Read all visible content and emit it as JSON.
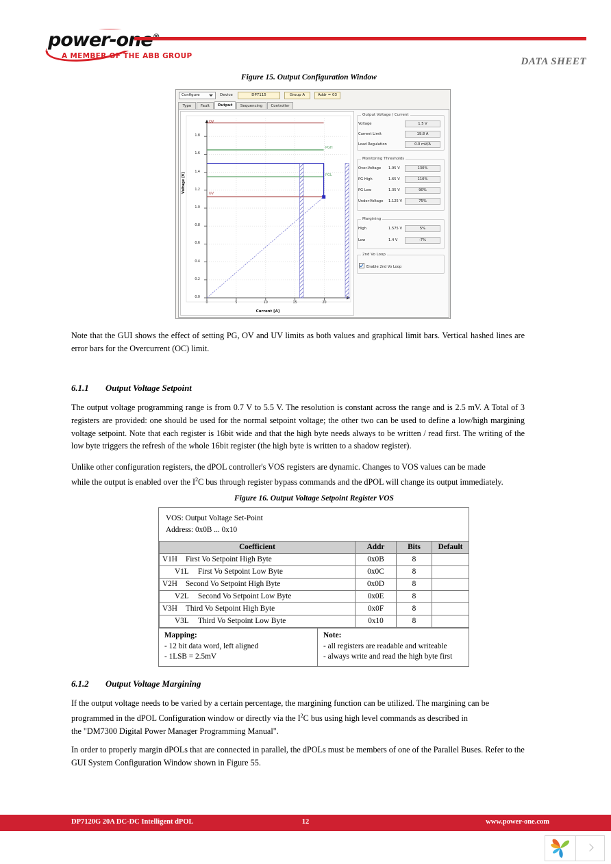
{
  "header": {
    "logo_wordmark": "power-one",
    "logo_registered": "®",
    "logo_tagline": "A MEMBER OF THE ABB GROUP",
    "datasheet_label": "DATA SHEET"
  },
  "figure15": {
    "caption": "Figure 15. Output Configuration Window",
    "toolbar": {
      "mode_select": "Configure",
      "device_label": "Device",
      "device_value": "DP7115",
      "group_value": "Group A",
      "addr_value": "Addr = 03"
    },
    "tabs": [
      {
        "label": "Type",
        "active": false
      },
      {
        "label": "Fault",
        "active": false
      },
      {
        "label": "Output",
        "active": true
      },
      {
        "label": "Sequencing",
        "active": false
      },
      {
        "label": "Controller",
        "active": false
      }
    ],
    "groups": {
      "output_vi": "Output Voltage / Current",
      "monitoring": "Monitoring Thresholds",
      "margining": "Margining",
      "second_loop": "2nd Vo Loop"
    },
    "output_vi_rows": [
      {
        "name": "Voltage",
        "mid": "",
        "value": "1.5 V"
      },
      {
        "name": "Current Limit",
        "mid": "",
        "value": "19.8 A"
      },
      {
        "name": "Load Regulation",
        "mid": "",
        "value": "0.0 mV/A"
      }
    ],
    "monitoring_rows": [
      {
        "name": "Over-Voltage",
        "mid": "1.95 V",
        "value": "130%"
      },
      {
        "name": "PG High",
        "mid": "1.65 V",
        "value": "110%"
      },
      {
        "name": "PG Low",
        "mid": "1.35 V",
        "value": "90%"
      },
      {
        "name": "Under-Voltage",
        "mid": "1.125 V",
        "value": "75%"
      }
    ],
    "margining_rows": [
      {
        "name": "High",
        "mid": "1.575 V",
        "value": "5%"
      },
      {
        "name": "Low",
        "mid": "1.4 V",
        "value": "-7%"
      }
    ],
    "checkbox_label": "Enable 2nd Vo Loop",
    "checkbox_checked": true,
    "colors": {
      "ov_uv": "#a33a3a",
      "pg": "#5fa46a",
      "setpoint": "#2b2bbd",
      "hatch": "#6a6ac8"
    }
  },
  "chart_data": {
    "type": "line",
    "title": "",
    "xlabel": "Current [A]",
    "ylabel": "Voltage [V]",
    "xlim": [
      0,
      24
    ],
    "ylim": [
      0.0,
      2.0
    ],
    "xticks": [
      0,
      5,
      10,
      15,
      20
    ],
    "yticks": [
      "0.0",
      "0.2",
      "0.4",
      "0.6",
      "0.8",
      "1.0",
      "1.2",
      "1.4",
      "1.6",
      "1.8"
    ],
    "grid": true,
    "legend": "none",
    "annotations": [
      "OV",
      "PGH",
      "PGL",
      "UV"
    ],
    "series": [
      {
        "name": "OV",
        "label": "OV",
        "type": "hline",
        "y": 1.95,
        "x_end": 19.8,
        "color": "#a33a3a"
      },
      {
        "name": "PGH",
        "label": "PGH",
        "type": "hline",
        "y": 1.65,
        "x_end": 19.8,
        "color": "#5fa46a"
      },
      {
        "name": "Setpoint",
        "label": "",
        "type": "hline",
        "y": 1.5,
        "x_end": 19.8,
        "color": "#2b2bbd"
      },
      {
        "name": "PGL",
        "label": "PGL",
        "type": "hline",
        "y": 1.35,
        "x_end": 19.8,
        "color": "#5fa46a"
      },
      {
        "name": "UV",
        "label": "UV",
        "type": "hline",
        "y": 1.125,
        "x_end": 19.8,
        "color": "#a33a3a"
      },
      {
        "name": "Droop",
        "label": "",
        "type": "diagonal",
        "x": [
          0,
          19.8
        ],
        "y": [
          0.0,
          1.125
        ],
        "color": "#8a8ad8"
      },
      {
        "name": "OC error bar low",
        "label": "",
        "type": "vhatch",
        "x": 15.8,
        "y_top": 1.5
      },
      {
        "name": "OC error bar high",
        "label": "",
        "type": "vhatch",
        "x": 23.6,
        "y_top": 1.5
      },
      {
        "name": "Setpoint drop",
        "label": "",
        "type": "vline",
        "x": 19.8,
        "y_from": 1.5,
        "y_to": 1.125,
        "color": "#2b2bbd"
      }
    ]
  },
  "body": {
    "note_para": "Note that the GUI shows the effect of setting PG, OV and UV limits as both values and graphical limit bars. Vertical hashed lines are error bars for the Overcurrent (OC) limit.",
    "sec_611_num": "6.1.1",
    "sec_611_title": "Output Voltage Setpoint",
    "para_611_a": "The output voltage programming range is from 0.7 V to 5.5 V. The resolution is constant across the range and is 2.5 mV. A Total of 3 registers are provided: one should be used for the normal setpoint voltage; the other two can be used to define a low/high margining voltage setpoint. Note that each register is 16bit wide and that the high byte needs always to be written / read first. The writing of the low byte triggers the refresh of the whole 16bit register (the high byte is written to a shadow register).",
    "para_611_b_1": "Unlike other configuration registers, the dPOL controller's VOS registers are dynamic. Changes to VOS values can be made",
    "para_611_b_2a": "while the output is enabled over the I",
    "para_611_b_sup": "2",
    "para_611_b_2b": "C bus through register bypass commands and the dPOL will change its output immediately.",
    "sec_612_num": "6.1.2",
    "sec_612_title": "Output Voltage Margining",
    "para_612_a_1": "If the output voltage needs to be varied by a certain percentage, the margining function can be utilized. The margining can be",
    "para_612_a_2a": "programmed in the dPOL Configuration window or directly via the I",
    "para_612_a_sup": "2",
    "para_612_a_2b": "C bus using high level commands as described in",
    "para_612_a_3": "the \"DM7300 Digital Power Manager Programming Manual\".",
    "para_612_b": "In order to properly margin dPOLs that are connected in parallel, the dPOLs must be members of one of the Parallel Buses. Refer to the GUI System Configuration Window shown in Figure 55."
  },
  "figure16": {
    "caption": "Figure 16. Output Voltage Setpoint Register VOS",
    "title_line1": "VOS: Output Voltage Set-Point",
    "title_line2": "Address: 0x0B ... 0x10",
    "columns": [
      "",
      "Coefficient",
      "Addr",
      "Bits",
      "Default"
    ],
    "rows": [
      {
        "code": "V1H",
        "desc": "First Vo Setpoint High Byte",
        "addr": "0x0B",
        "bits": "8",
        "default": ""
      },
      {
        "code": "V1L",
        "desc": "First Vo Setpoint Low Byte",
        "addr": "0x0C",
        "bits": "8",
        "default": ""
      },
      {
        "code": "V2H",
        "desc": "Second Vo Setpoint High Byte",
        "addr": "0x0D",
        "bits": "8",
        "default": ""
      },
      {
        "code": "V2L",
        "desc": "Second Vo Setpoint Low Byte",
        "addr": "0x0E",
        "bits": "8",
        "default": ""
      },
      {
        "code": "V3H",
        "desc": "Third Vo Setpoint High Byte",
        "addr": "0x0F",
        "bits": "8",
        "default": ""
      },
      {
        "code": "V3L",
        "desc": "Third Vo Setpoint Low Byte",
        "addr": "0x10",
        "bits": "8",
        "default": ""
      }
    ],
    "mapping_title": "Mapping:",
    "mapping_lines": [
      "- 12 bit data word, left aligned",
      "- 1LSB = 2.5mV"
    ],
    "note_title": "Note:",
    "note_lines": [
      "- all registers are readable and writeable",
      "- always write and read the high byte first"
    ]
  },
  "footer": {
    "left": "DP7120G 20A DC-DC Intelligent dPOL",
    "page": "12",
    "right": "www.power-one.com"
  }
}
